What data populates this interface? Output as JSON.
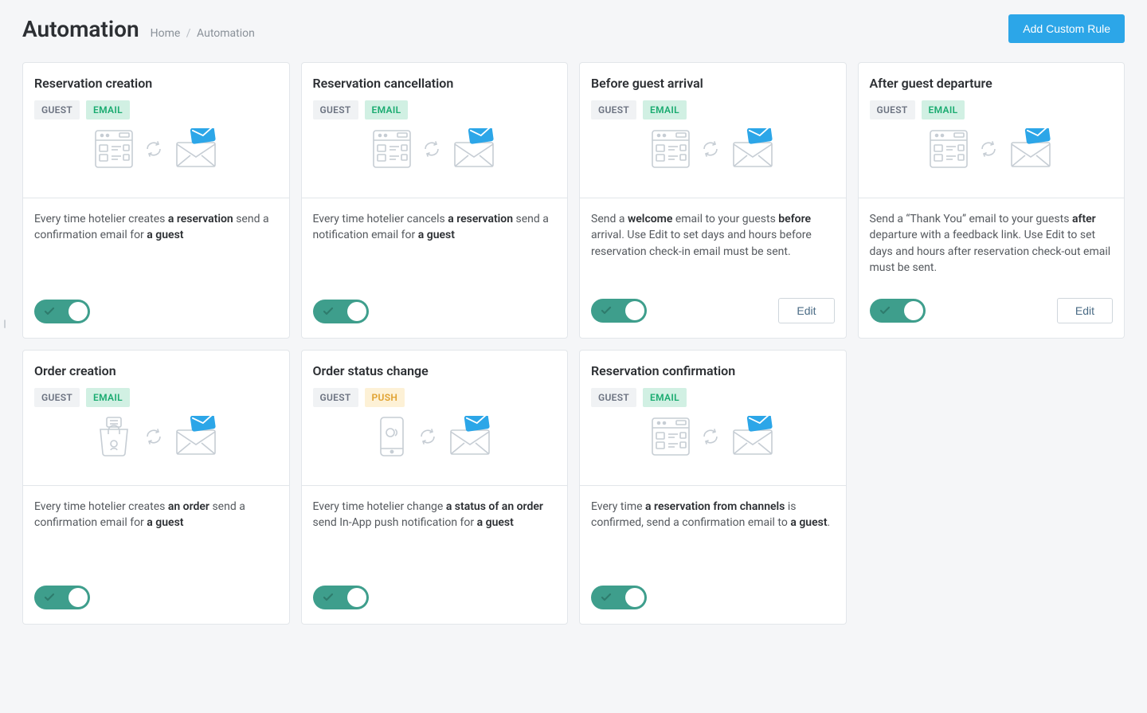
{
  "header": {
    "title": "Automation",
    "breadcrumb_home": "Home",
    "breadcrumb_current": "Automation",
    "add_button": "Add Custom Rule"
  },
  "tags": {
    "guest": "GUEST",
    "email": "EMAIL",
    "push": "PUSH"
  },
  "edit_label": "Edit",
  "cards": [
    {
      "title": "Reservation creation",
      "tag2": "email",
      "icon": "reservation",
      "desc_pre": "Every time hotelier creates ",
      "desc_b1": "a reservation",
      "desc_mid": " send a confirmation email for ",
      "desc_b2": "a guest",
      "desc_post": "",
      "has_edit": false
    },
    {
      "title": "Reservation cancellation",
      "tag2": "email",
      "icon": "reservation",
      "desc_pre": "Every time hotelier cancels ",
      "desc_b1": "a reservation",
      "desc_mid": " send a notification email for ",
      "desc_b2": "a guest",
      "desc_post": "",
      "has_edit": false
    },
    {
      "title": "Before guest arrival",
      "tag2": "email",
      "icon": "reservation",
      "desc_pre": "Send a ",
      "desc_b1": "welcome",
      "desc_mid": " email to your guests ",
      "desc_b2": "before",
      "desc_post": " arrival. Use Edit to set days and hours before reservation check-in email must be sent.",
      "has_edit": true
    },
    {
      "title": "After guest departure",
      "tag2": "email",
      "icon": "reservation",
      "desc_pre": "Send a “Thank You” email to your guests ",
      "desc_b1": "after",
      "desc_mid": " departure with a feedback link. Use Edit to set days and hours after reservation check-out email must be sent.",
      "desc_b2": "",
      "desc_post": "",
      "has_edit": true
    },
    {
      "title": "Order creation",
      "tag2": "email",
      "icon": "order",
      "desc_pre": "Every time hotelier creates ",
      "desc_b1": "an order",
      "desc_mid": " send a confirmation email for ",
      "desc_b2": "a guest",
      "desc_post": "",
      "has_edit": false
    },
    {
      "title": "Order status change",
      "tag2": "push",
      "icon": "phone",
      "desc_pre": "Every time hotelier change ",
      "desc_b1": "a status of an order",
      "desc_mid": " send In-App push notification for ",
      "desc_b2": "a guest",
      "desc_post": "",
      "has_edit": false
    },
    {
      "title": "Reservation confirmation",
      "tag2": "email",
      "icon": "reservation",
      "desc_pre": "Every time ",
      "desc_b1": "a reservation from channels",
      "desc_mid": " is confirmed, send a confirmation email to ",
      "desc_b2": "a guest",
      "desc_post": ".",
      "has_edit": false
    }
  ]
}
